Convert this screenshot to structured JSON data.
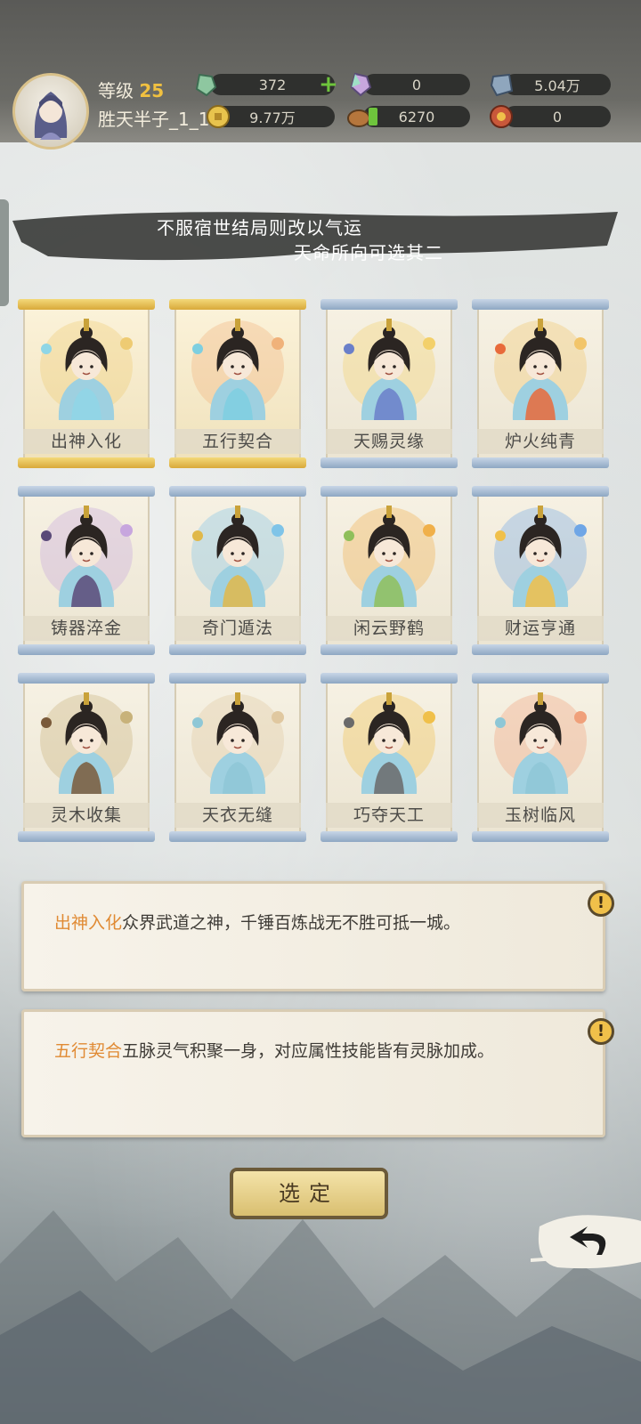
{
  "player": {
    "level_label": "等级",
    "level": "25",
    "name": "胜天半子_1_1"
  },
  "resources": [
    {
      "icon": "green-crystal-icon",
      "value": "372",
      "has_plus": true
    },
    {
      "icon": "rainbow-crystal-icon",
      "value": "0"
    },
    {
      "icon": "spirit-stone-icon",
      "value": "5.04万"
    },
    {
      "icon": "gold-coin-icon",
      "value": "9.77万"
    },
    {
      "icon": "leather-bag-icon",
      "value": "6270"
    },
    {
      "icon": "red-token-icon",
      "value": "0"
    }
  ],
  "banner": {
    "line1": "不服宿世结局则改以气运",
    "line2": "天命所向可选其二"
  },
  "cards": [
    {
      "label": "出神入化",
      "selected": true
    },
    {
      "label": "五行契合",
      "selected": true
    },
    {
      "label": "天赐灵缘",
      "selected": false
    },
    {
      "label": "炉火纯青",
      "selected": false
    },
    {
      "label": "铸器淬金",
      "selected": false
    },
    {
      "label": "奇门遁法",
      "selected": false
    },
    {
      "label": "闲云野鹤",
      "selected": false
    },
    {
      "label": "财运亨通",
      "selected": false
    },
    {
      "label": "灵木收集",
      "selected": false
    },
    {
      "label": "天衣无缝",
      "selected": false
    },
    {
      "label": "巧夺天工",
      "selected": false
    },
    {
      "label": "玉树临风",
      "selected": false
    }
  ],
  "descriptions": [
    {
      "title": "出神入化",
      "text": "众界武道之神，千锤百炼战无不胜可抵一城。"
    },
    {
      "title": "五行契合",
      "text": "五脉灵气积聚一身，对应属性技能皆有灵脉加成。"
    }
  ],
  "actions": {
    "confirm_label": "选定"
  },
  "colors": {
    "highlight": "#e08a33",
    "gold_rod": "#d9a93a",
    "blue_rod": "#8ea7c2"
  }
}
